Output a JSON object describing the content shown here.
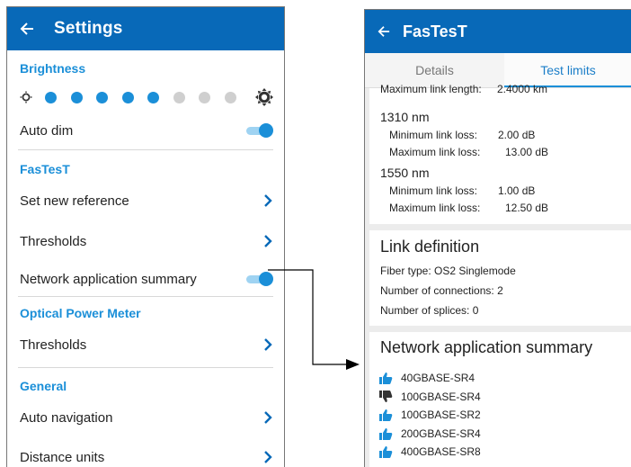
{
  "left": {
    "title": "Settings",
    "sections": {
      "brightness": "Brightness",
      "fastest": "FasTesT",
      "opm": "Optical Power Meter",
      "general": "General"
    },
    "brightness_level": {
      "filled": 5,
      "total": 8
    },
    "rows": {
      "auto_dim": "Auto dim",
      "set_new_reference": "Set new reference",
      "thresholds_fastest": "Thresholds",
      "network_app_summary": "Network application summary",
      "thresholds_opm": "Thresholds",
      "auto_navigation": "Auto navigation",
      "distance_units": "Distance units"
    },
    "toggles": {
      "auto_dim": true,
      "network_app_summary": true
    }
  },
  "right": {
    "title": "FasTesT",
    "tabs": [
      "Details",
      "Test limits"
    ],
    "active_tab": "Test limits",
    "limits": {
      "partial_label": "Maximum link length:",
      "partial_value": "2.4000 km",
      "nm1310": {
        "title": "1310 nm",
        "min_label": "Minimum link loss:",
        "min_value": "2.00 dB",
        "max_label": "Maximum link loss:",
        "max_value": "13.00 dB"
      },
      "nm1550": {
        "title": "1550 nm",
        "min_label": "Minimum link loss:",
        "min_value": "1.00 dB",
        "max_label": "Maximum link loss:",
        "max_value": "12.50 dB"
      }
    },
    "link_definition": {
      "title": "Link definition",
      "fiber_type": "Fiber type:  OS2 Singlemode",
      "connections": "Number of connections:  2",
      "splices": "Number of splices:  0"
    },
    "network_summary": {
      "title": "Network application summary",
      "apps": [
        {
          "name": "40GBASE-SR4",
          "status": "pass",
          "icon": "thumbs-up-icon"
        },
        {
          "name": "100GBASE-SR4",
          "status": "fail",
          "icon": "thumbs-down-icon"
        },
        {
          "name": "100GBASE-SR2",
          "status": "pass",
          "icon": "thumbs-up-icon"
        },
        {
          "name": "200GBASE-SR4",
          "status": "pass",
          "icon": "thumbs-up-icon"
        },
        {
          "name": "400GBASE-SR8",
          "status": "pass",
          "icon": "thumbs-up-icon"
        }
      ]
    }
  },
  "colors": {
    "accent": "#0869b8",
    "highlight": "#1b8fd8",
    "pass": "#1b8fd8",
    "fail": "#333333"
  }
}
